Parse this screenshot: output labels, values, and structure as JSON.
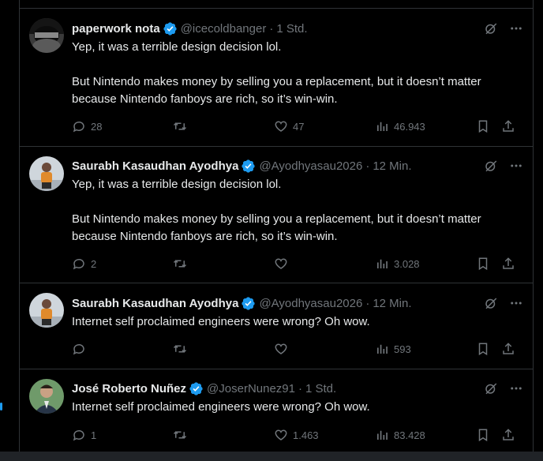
{
  "tweets": [
    {
      "name": "paperwork nota",
      "handle": "@icecoldbanger",
      "time": "1 Std.",
      "paragraphs": [
        "Yep, it was a terrible design decision lol.",
        "But Nintendo makes money by selling you a replacement, but it doesn’t matter because Nintendo fanboys are rich, so it’s win-win."
      ],
      "replies": "28",
      "retweets": "",
      "likes": "47",
      "views": "46.943",
      "verified": true,
      "avatar": "dark-masked-avatar"
    },
    {
      "name": "Saurabh Kasaudhan Ayodhya",
      "handle": "@Ayodhyasau2026",
      "time": "12 Min.",
      "paragraphs": [
        "Yep, it was a terrible design decision lol.",
        "But Nintendo makes money by selling you a replacement, but it doesn’t matter because Nintendo fanboys are rich, so it’s win-win."
      ],
      "replies": "2",
      "retweets": "",
      "likes": "",
      "views": "3.028",
      "verified": true,
      "avatar": "person-avatar"
    },
    {
      "name": "Saurabh Kasaudhan Ayodhya",
      "handle": "@Ayodhyasau2026",
      "time": "12 Min.",
      "paragraphs": [
        "Internet self proclaimed engineers were wrong? Oh wow."
      ],
      "replies": "",
      "retweets": "",
      "likes": "",
      "views": "593",
      "verified": true,
      "avatar": "person-avatar"
    },
    {
      "name": "José Roberto Nuñez",
      "handle": "@JoserNunez91",
      "time": "1 Std.",
      "paragraphs": [
        "Internet self proclaimed engineers were wrong? Oh wow."
      ],
      "replies": "1",
      "retweets": "",
      "likes": "1.463",
      "views": "83.428",
      "verified": true,
      "avatar": "man-in-suit-avatar"
    }
  ],
  "separator": "·",
  "colors": {
    "background": "#000000",
    "text": "#e7e9ea",
    "muted": "#71767b",
    "verified": "#1d9bf0",
    "border": "#2f3336"
  },
  "icons": [
    "grok-icon",
    "more-icon",
    "reply-icon",
    "retweet-icon",
    "like-icon",
    "views-icon",
    "bookmark-icon",
    "share-icon",
    "verified-badge-icon"
  ]
}
